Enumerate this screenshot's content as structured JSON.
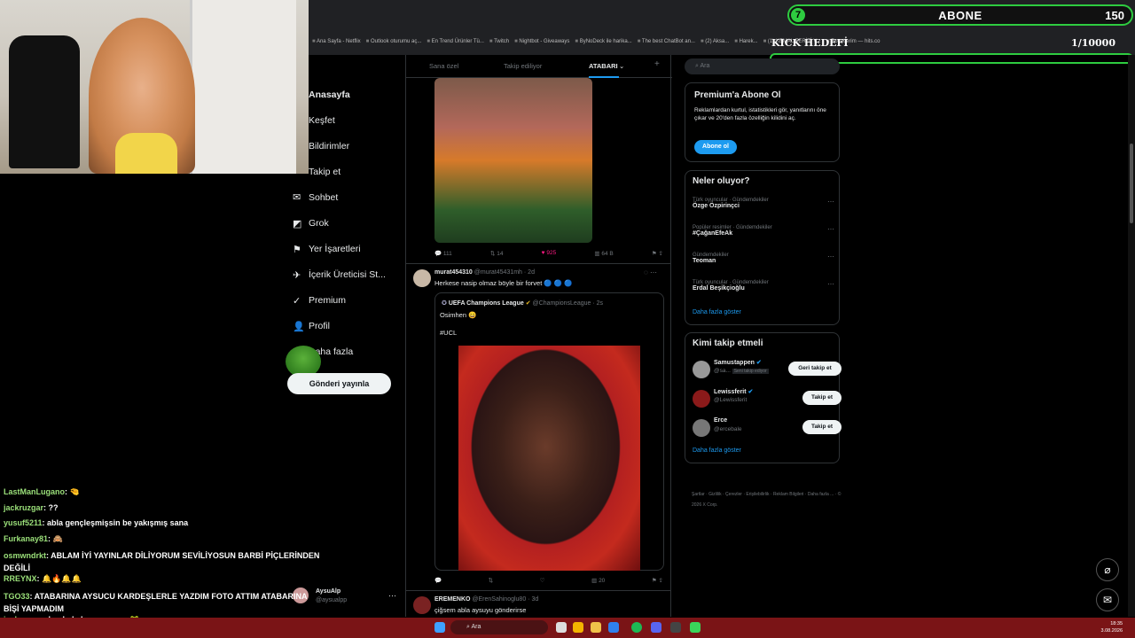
{
  "overlay": {
    "abone_num": "7",
    "abone_label": "ABONE",
    "abone_count": "150",
    "kick_label": "KICK HEDEFİ",
    "kick_count": "1/10000"
  },
  "bookmarks": [
    "Ana Sayfa - Netflix",
    "Outlook oturumu aç...",
    "En Trend Ürünler Tü...",
    "Twitch",
    "Nightbot - Giveaways",
    "ByNoDeck ile harika...",
    "The best ChatBot an...",
    "(2) Aksa...",
    "Harek...",
    "(1) KEMAL FERİTİ V...",
    "Rozetlerim — hits.co"
  ],
  "nav": {
    "items": [
      {
        "label": "Anasayfa",
        "icon": "⌂"
      },
      {
        "label": "Keşfet",
        "icon": "⌕"
      },
      {
        "label": "Bildirimler",
        "icon": "🔔"
      },
      {
        "label": "Takip et",
        "icon": "⚇"
      },
      {
        "label": "Sohbet",
        "icon": "✉"
      },
      {
        "label": "Grok",
        "icon": "◩"
      },
      {
        "label": "Yer İşaretleri",
        "icon": "⚑"
      },
      {
        "label": "İçerik Üreticisi St...",
        "icon": "✈"
      },
      {
        "label": "Premium",
        "icon": "✓"
      },
      {
        "label": "Profil",
        "icon": "👤"
      },
      {
        "label": "Daha fazla",
        "icon": "⋯"
      }
    ],
    "post_button": "Gönderi yayınla"
  },
  "feed": {
    "tabs": [
      "Sana özel",
      "Takip ediliyor",
      "ATABARI"
    ],
    "tweet1": {
      "replies": "111",
      "retweets": "14",
      "likes": "925",
      "views": "64 B"
    },
    "tweet2": {
      "name": "murat454310",
      "handle": "@murat45431mh · 2d",
      "text": "Herkese nasip olmaz böyle bir forvet 🔵 🔵 🔵",
      "quote_name": "UEFA Champions League",
      "quote_handle": "@ChampionsLeague · 2s",
      "quote_text": "Osimhen 😄",
      "quote_tag": "#UCL",
      "views": "20"
    },
    "tweet3": {
      "name": "EREMENKO",
      "handle": "@ErenSahinoglu80 · 3d",
      "text": "çiğsem abla aysuyu gönderirse"
    }
  },
  "right": {
    "search_placeholder": "Ara",
    "premium": {
      "title": "Premium'a Abone Ol",
      "text": "Reklamlardan kurtul, istatistikleri gör, yanıtlarını öne çıkar ve 20'den fazla özelliğin kilidini aç.",
      "button": "Abone ol"
    },
    "news": {
      "title": "Neler oluyor?",
      "trends": [
        {
          "sub": "Türk oyuncular · Gündemdekiler",
          "name": "Özge Özpirinçci"
        },
        {
          "sub": "Popüler resimler · Gündemdekiler",
          "name": "#ÇağanEfeAk"
        },
        {
          "sub": "Gündemdekiler",
          "name": "Teoman"
        },
        {
          "sub": "Türk oyuncular · Gündemdekiler",
          "name": "Erdal Beşikçioğlu"
        }
      ],
      "more": "Daha fazla göster"
    },
    "who": {
      "title": "Kimi takip etmeli",
      "users": [
        {
          "name": "Samustappen",
          "handle": "@sa...",
          "badge": "Seni takip ediyor",
          "button": "Geri takip et"
        },
        {
          "name": "Lewissferit",
          "handle": "@Lewissferit",
          "button": "Takip et"
        },
        {
          "name": "Erce",
          "handle": "@ercebale",
          "button": "Takip et"
        }
      ],
      "more": "Daha fazla göster"
    },
    "footer": "Şartlar · Gizlilik · Çerezler · Erişilebilirlik · Reklam Bilgileri · Daha fazla ... · © 2026 X Corp."
  },
  "chat": [
    {
      "user": "LastManLugano",
      "msg": ": 🤏"
    },
    {
      "user": "jackruzgar",
      "msg": ": ??"
    },
    {
      "user": "yusuf5211",
      "msg": ": abla gençleşmişsin be yakışmış sana"
    },
    {
      "user": "Furkanay81",
      "msg": ": 🙈"
    },
    {
      "user": "osmwndrkt",
      "msg": ": ABLAM İYİ YAYINLAR DİLİYORUM SEVİLİYOSUN BARBİ PİÇLERİNDEN DEĞİLİ"
    },
    {
      "user": "RREYNX",
      "msg": ": 🔔🔥🔔🔔"
    },
    {
      "user": "TGO33",
      "msg": ": ATABARINA AYSUCU KARDEŞLERLE YAZDIM FOTO ATTIM ATABARINA BİŞİ YAPMADIM"
    },
    {
      "user": "jackruzgar",
      "msg": ": benlede barışacanmı 🐸"
    }
  ],
  "account": {
    "name": "AysuAlp",
    "handle": "@aysualpp"
  },
  "taskbar": {
    "search": "Ara",
    "time": "18:35",
    "date": "3.08.2026"
  },
  "colors": {
    "accent": "#1d9bf0",
    "goal": "#2ecc40",
    "taskbar": "#7a1416"
  }
}
